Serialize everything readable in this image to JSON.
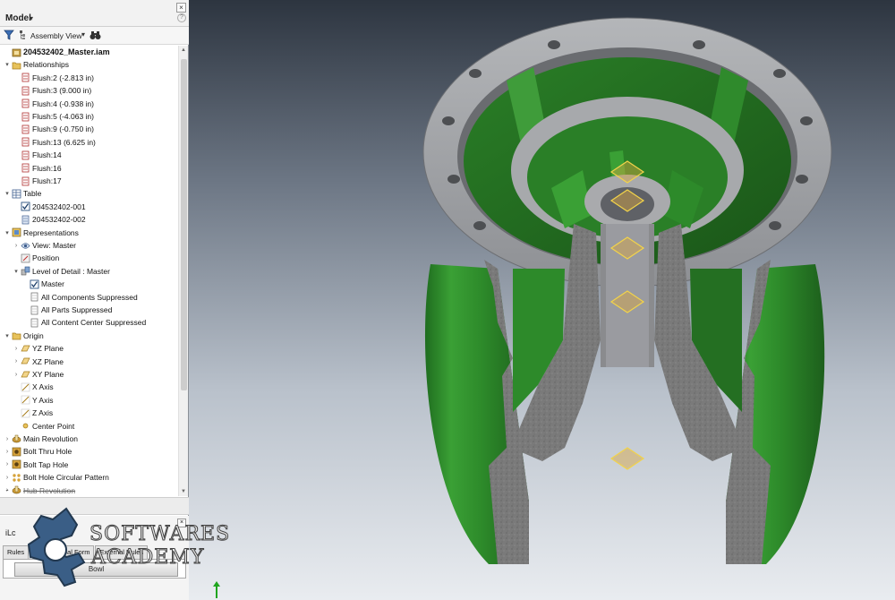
{
  "browser": {
    "title": "Model",
    "dropdown_glyph": "▾",
    "close_glyph": "×",
    "help_glyph": "?",
    "toolbar": {
      "filter_icon": "filter-icon",
      "view_label": "Assembly View",
      "dropdown_glyph": "▾",
      "find_icon": "binoculars-icon"
    },
    "tree": [
      {
        "label": "204532402_Master.iam",
        "level": 0,
        "toggle": "",
        "icon": "assembly-icon",
        "style": "bold"
      },
      {
        "label": "Relationships",
        "level": 0,
        "toggle": "▾",
        "icon": "folder-icon"
      },
      {
        "label": "Flush:2 (-2.813 in)",
        "level": 1,
        "toggle": "",
        "icon": "constraint-icon"
      },
      {
        "label": "Flush:3 (9.000 in)",
        "level": 1,
        "toggle": "",
        "icon": "constraint-icon"
      },
      {
        "label": "Flush:4 (-0.938 in)",
        "level": 1,
        "toggle": "",
        "icon": "constraint-icon"
      },
      {
        "label": "Flush:5 (-4.063 in)",
        "level": 1,
        "toggle": "",
        "icon": "constraint-icon"
      },
      {
        "label": "Flush:9 (-0.750 in)",
        "level": 1,
        "toggle": "",
        "icon": "constraint-icon"
      },
      {
        "label": "Flush:13 (6.625 in)",
        "level": 1,
        "toggle": "",
        "icon": "constraint-icon"
      },
      {
        "label": "Flush:14",
        "level": 1,
        "toggle": "",
        "icon": "constraint-icon"
      },
      {
        "label": "Flush:16",
        "level": 1,
        "toggle": "",
        "icon": "constraint-icon"
      },
      {
        "label": "Flush:17",
        "level": 1,
        "toggle": "",
        "icon": "constraint-icon"
      },
      {
        "label": "Table",
        "level": 0,
        "toggle": "▾",
        "icon": "table-icon"
      },
      {
        "label": "204532402-001",
        "level": 1,
        "toggle": "",
        "icon": "checkbox-icon"
      },
      {
        "label": "204532402-002",
        "level": 1,
        "toggle": "",
        "icon": "table-row-icon"
      },
      {
        "label": "Representations",
        "level": 0,
        "toggle": "▾",
        "icon": "representations-icon"
      },
      {
        "label": "View: Master",
        "level": 1,
        "toggle": "›",
        "icon": "view-rep-icon"
      },
      {
        "label": "Position",
        "level": 1,
        "toggle": "",
        "icon": "position-icon"
      },
      {
        "label": "Level of Detail : Master",
        "level": 1,
        "toggle": "▾",
        "icon": "lod-icon"
      },
      {
        "label": "Master",
        "level": 2,
        "toggle": "",
        "icon": "checkbox-icon"
      },
      {
        "label": "All Components Suppressed",
        "level": 2,
        "toggle": "",
        "icon": "lod-item-icon"
      },
      {
        "label": "All Parts Suppressed",
        "level": 2,
        "toggle": "",
        "icon": "lod-item-icon"
      },
      {
        "label": "All Content Center Suppressed",
        "level": 2,
        "toggle": "",
        "icon": "lod-item-icon"
      },
      {
        "label": "Origin",
        "level": 0,
        "toggle": "▾",
        "icon": "folder-icon"
      },
      {
        "label": "YZ Plane",
        "level": 1,
        "toggle": "›",
        "icon": "plane-icon"
      },
      {
        "label": "XZ Plane",
        "level": 1,
        "toggle": "›",
        "icon": "plane-icon"
      },
      {
        "label": "XY Plane",
        "level": 1,
        "toggle": "›",
        "icon": "plane-icon"
      },
      {
        "label": "X Axis",
        "level": 1,
        "toggle": "",
        "icon": "axis-icon"
      },
      {
        "label": "Y Axis",
        "level": 1,
        "toggle": "",
        "icon": "axis-icon"
      },
      {
        "label": "Z Axis",
        "level": 1,
        "toggle": "",
        "icon": "axis-icon"
      },
      {
        "label": "Center Point",
        "level": 1,
        "toggle": "",
        "icon": "point-icon"
      },
      {
        "label": "Main Revolution",
        "level": 0,
        "toggle": "›",
        "icon": "revolve-icon"
      },
      {
        "label": "Bolt Thru Hole",
        "level": 0,
        "toggle": "›",
        "icon": "hole-icon"
      },
      {
        "label": "Bolt Tap Hole",
        "level": 0,
        "toggle": "›",
        "icon": "hole-icon"
      },
      {
        "label": "Bolt Hole Circular Pattern",
        "level": 0,
        "toggle": "›",
        "icon": "pattern-icon"
      },
      {
        "label": "Hub Revolution",
        "level": 0,
        "toggle": "›",
        "icon": "revolve-icon",
        "style": "strike"
      }
    ]
  },
  "ilogic": {
    "title": "iLc",
    "close_glyph": "×",
    "tabs": [
      {
        "label": "Rules",
        "active": false
      },
      {
        "label": "ms",
        "active": true
      },
      {
        "label": "Global Form",
        "active": false
      },
      {
        "label": "External Rules",
        "active": false
      }
    ],
    "button_label": "Bowl"
  },
  "watermark": {
    "line1": "SOFTWARES",
    "line2": "ACADEMY"
  },
  "colors": {
    "model_green": "#2f8a2c",
    "cut_face": "#7c7c7c",
    "flange_gray": "#a9aaad",
    "highlight": "#e8c53b"
  }
}
